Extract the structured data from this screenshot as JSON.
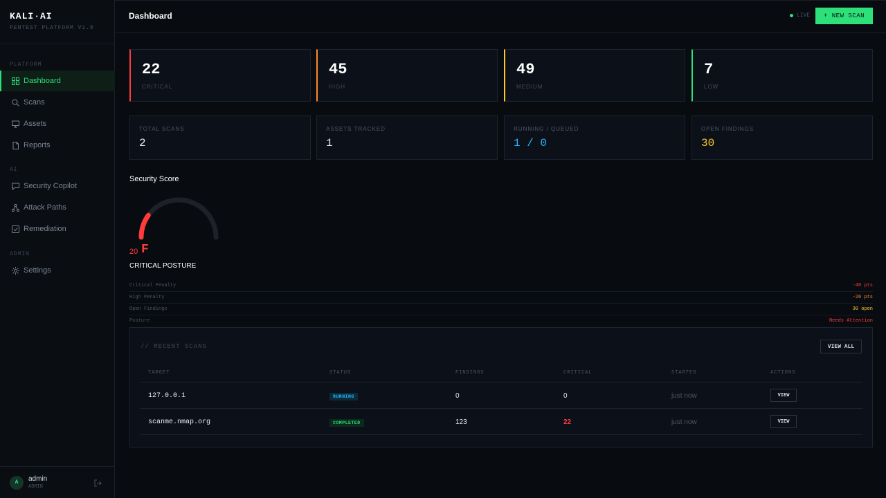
{
  "brand": {
    "title": "KALI·AI",
    "subtitle": "PENTEST PLATFORM V1.0"
  },
  "sidebar": {
    "sections": [
      {
        "label": "PLATFORM",
        "items": [
          {
            "label": "Dashboard",
            "icon": "grid-icon",
            "active": true
          },
          {
            "label": "Scans",
            "icon": "search-icon"
          },
          {
            "label": "Assets",
            "icon": "monitor-icon"
          },
          {
            "label": "Reports",
            "icon": "file-icon"
          }
        ]
      },
      {
        "label": "AI",
        "items": [
          {
            "label": "Security Copilot",
            "icon": "chat-icon"
          },
          {
            "label": "Attack Paths",
            "icon": "nodes-icon"
          },
          {
            "label": "Remediation",
            "icon": "check-square-icon"
          }
        ]
      },
      {
        "label": "ADMIN",
        "items": [
          {
            "label": "Settings",
            "icon": "gear-icon"
          }
        ]
      }
    ]
  },
  "user": {
    "initial": "A",
    "name": "admin",
    "role": "ADMIN"
  },
  "header": {
    "title": "Dashboard",
    "live_label": "LIVE",
    "new_scan_label": "+ NEW SCAN"
  },
  "severity": [
    {
      "value": "22",
      "label": "CRITICAL",
      "color": "#ff3b3b"
    },
    {
      "value": "45",
      "label": "HIGH",
      "color": "#ff8a2a"
    },
    {
      "value": "49",
      "label": "MEDIUM",
      "color": "#ffc72a"
    },
    {
      "value": "7",
      "label": "LOW",
      "color": "#2ee07a"
    }
  ],
  "stats": [
    {
      "label": "TOTAL SCANS",
      "value": "2",
      "color": "#e6ecf2"
    },
    {
      "label": "ASSETS TRACKED",
      "value": "1",
      "color": "#e6ecf2"
    },
    {
      "label": "RUNNING / QUEUED",
      "value": "1 / 0",
      "color": "#26b7ff"
    },
    {
      "label": "OPEN FINDINGS",
      "value": "30",
      "color": "#ffc72a"
    }
  ],
  "score": {
    "title": "Security Score",
    "value": "20",
    "score_fraction": 0.2,
    "grade": "F",
    "posture": "CRITICAL POSTURE",
    "breakdown": [
      {
        "label": "Critical Penalty",
        "value": "-40 pts",
        "color": "#ff3b3b"
      },
      {
        "label": "High Penalty",
        "value": "-20 pts",
        "color": "#ff8a2a"
      },
      {
        "label": "Open Findings",
        "value": "30 open",
        "color": "#ffc72a"
      },
      {
        "label": "Posture",
        "value": "Needs Attention",
        "color": "#ff3b3b"
      }
    ]
  },
  "recent_scans": {
    "title": "// RECENT SCANS",
    "view_all_label": "VIEW ALL",
    "columns": [
      "TARGET",
      "STATUS",
      "FINDINGS",
      "CRITICAL",
      "STARTED",
      "ACTIONS"
    ],
    "rows": [
      {
        "target": "127.0.0.1",
        "status": "RUNNING",
        "findings": "0",
        "critical": "0",
        "started": "just now",
        "action": "VIEW"
      },
      {
        "target": "scanme.nmap.org",
        "status": "COMPLETED",
        "findings": "123",
        "critical": "22",
        "started": "just now",
        "action": "VIEW"
      }
    ]
  }
}
